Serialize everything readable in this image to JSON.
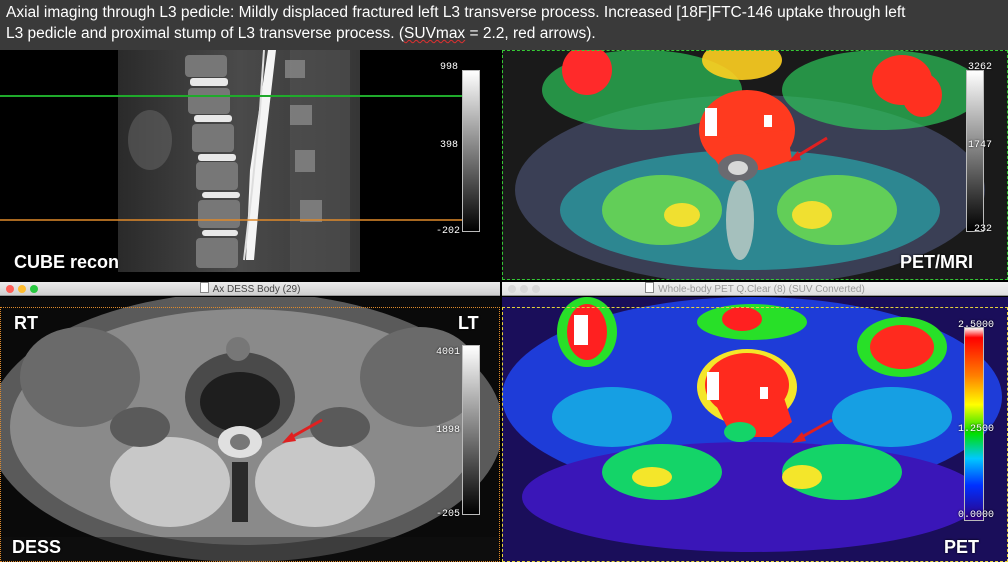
{
  "caption": {
    "line1": "Axial imaging through L3 pedicle: Mildly displaced fractured left L3 transverse process.  Increased [18F]FTC-146 uptake through left",
    "line2_pre": "L3 pedicle and proximal stump of L3 transverse process. (",
    "line2_squig": "SUVmax",
    "line2_post": " = 2.2, red arrows)."
  },
  "panels": {
    "cube": {
      "label": "CUBE recon",
      "scale": {
        "max": "998",
        "mid": "398",
        "min": "-202"
      }
    },
    "petmri": {
      "label": "PET/MRI",
      "scale": {
        "max": "3262",
        "mid": "1747",
        "min": "232"
      }
    },
    "dess": {
      "window_title": "Ax DESS Body (29)",
      "label": "DESS",
      "rt": "RT",
      "lt": "LT",
      "scale": {
        "max": "4001",
        "mid": "1898",
        "min": "-205"
      }
    },
    "pet": {
      "window_title": "Whole-body PET Q.Clear (8) (SUV Converted)",
      "label": "PET",
      "scale": {
        "max": "2.5000",
        "mid": "1.2500",
        "min": "0.0000"
      }
    }
  },
  "colors": {
    "green_line": "#1faa2b",
    "orange_line": "#e08a2a",
    "arrow": "#e02020",
    "traffic_red": "#ff5f57",
    "traffic_yellow": "#febc2e",
    "traffic_green": "#28c840"
  }
}
